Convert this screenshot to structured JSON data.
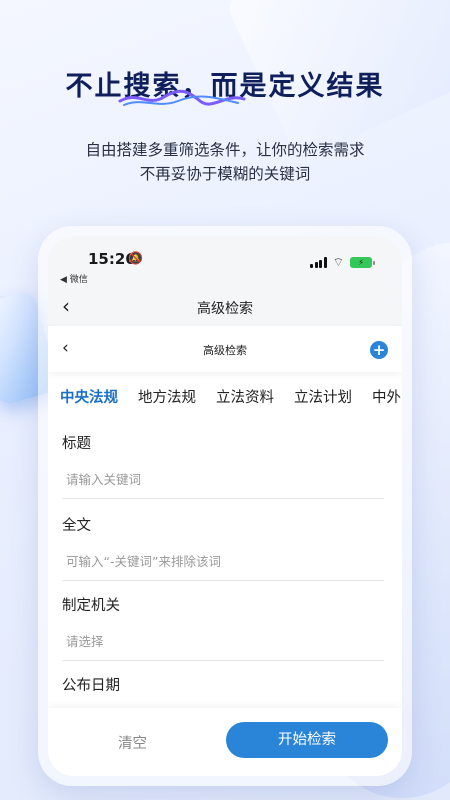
{
  "hero": {
    "title_part1": "不止",
    "title_highlight": "搜索",
    "title_part2": "，而是定义结果",
    "subtitle_line1": "自由搭建多重筛选条件，让你的检索需求",
    "subtitle_line2": "不再妥协于模糊的关键词"
  },
  "status_bar": {
    "time": "15:26",
    "back_app": "◀ 微信"
  },
  "nav_outer": {
    "back_icon": "chevron-left-icon",
    "title": "高级检索"
  },
  "nav_inner": {
    "back_icon": "chevron-left-icon",
    "title": "高级检索",
    "add_icon": "plus-circle-icon"
  },
  "tabs": [
    {
      "label": "中央法规",
      "active": true
    },
    {
      "label": "地方法规",
      "active": false
    },
    {
      "label": "立法资料",
      "active": false
    },
    {
      "label": "立法计划",
      "active": false
    },
    {
      "label": "中外",
      "active": false
    }
  ],
  "fields": {
    "title": {
      "label": "标题",
      "placeholder": "请输入关键词"
    },
    "fulltext": {
      "label": "全文",
      "placeholder": "可输入“-关键词”来排除该词"
    },
    "authority": {
      "label": "制定机关",
      "placeholder": "请选择"
    },
    "publish_date": {
      "label": "公布日期"
    }
  },
  "actions": {
    "clear": "清空",
    "search": "开始检索"
  },
  "colors": {
    "accent": "#2a85d8",
    "active_tab": "#1a6fc9",
    "hero_title": "#0f1f5c"
  }
}
